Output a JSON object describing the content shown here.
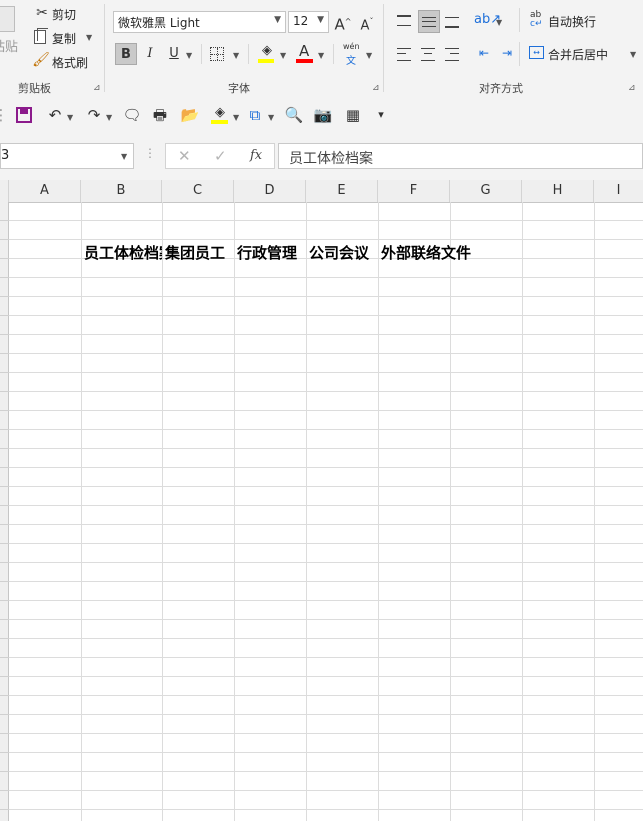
{
  "ribbon": {
    "clipboard": {
      "paste_label": "粘贴",
      "cut_label": "剪切",
      "copy_label": "复制",
      "format_painter_label": "格式刷",
      "group_label": "剪贴板"
    },
    "font": {
      "font_name": "微软雅黑 Light",
      "font_size": "12",
      "grow_glyph": "A",
      "shrink_glyph": "A",
      "bold_label": "B",
      "italic_label": "I",
      "underline_label": "U",
      "font_color_glyph": "A",
      "phonetic_top": "wén",
      "phonetic_bottom": "文",
      "group_label": "字体"
    },
    "alignment": {
      "wrap_text_label": "自动换行",
      "merge_center_label": "合并后居中",
      "group_label": "对齐方式"
    }
  },
  "formula_bar": {
    "name_box_value": "3",
    "fx_label": "fx",
    "formula_value": "员工体检档案"
  },
  "grid": {
    "columns": [
      "A",
      "B",
      "C",
      "D",
      "E",
      "F",
      "G",
      "H",
      "I"
    ],
    "cells": {
      "B": "员工体检档案",
      "C": "集团员工",
      "D": "行政管理",
      "E": "公司会议",
      "F": "外部联络文件"
    }
  },
  "colors": {
    "highlight_bar": "#ffff00",
    "font_color_bar": "#ff0000",
    "ribbon_bg": "#f3f3f3",
    "grid_line": "#dcdcdc"
  }
}
